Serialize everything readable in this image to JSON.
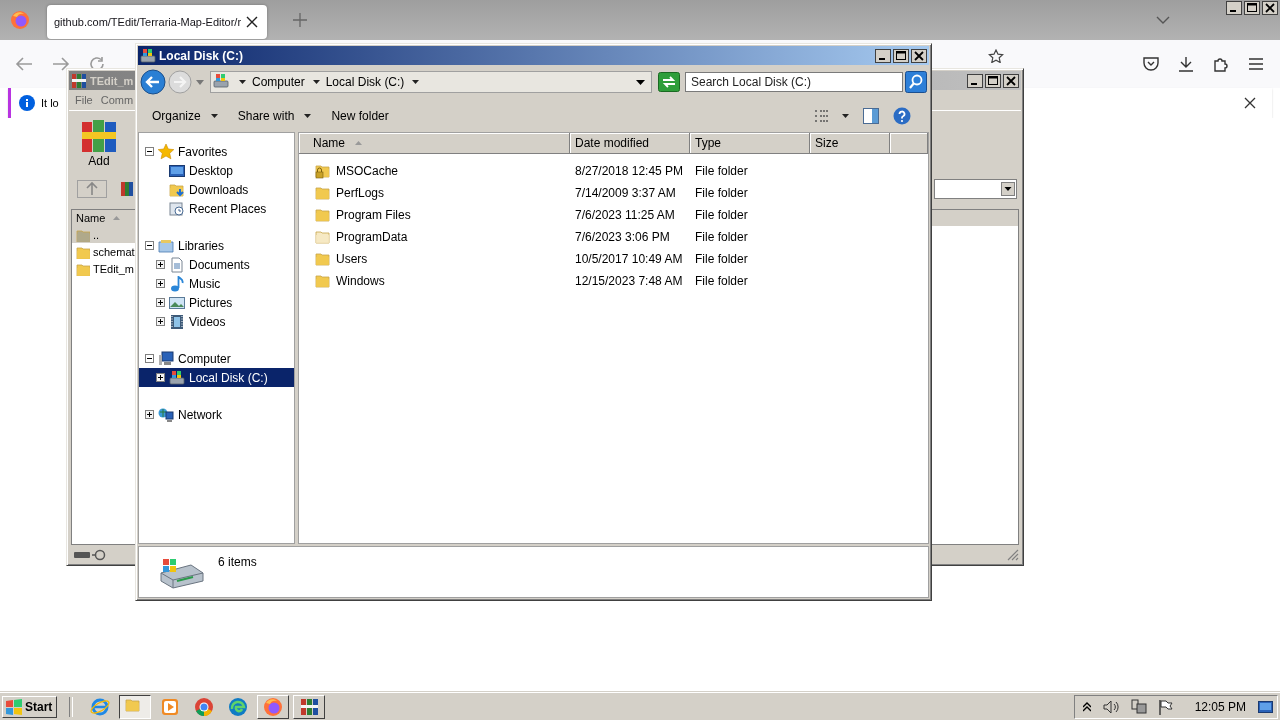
{
  "browser": {
    "tabs": [
      {
        "title": "github.com/TEdit/Terraria-Map-Editor/r",
        "selected": true
      }
    ],
    "notification": {
      "text": "It lo"
    }
  },
  "winrar": {
    "title": "TEdit_m",
    "menu": [
      "File",
      "Comm"
    ],
    "toolbar": [
      {
        "label": "Add"
      }
    ],
    "columns": [
      {
        "label": "Name",
        "sorted": true
      }
    ],
    "rows": [
      {
        "name": "..",
        "kind": "parent",
        "selected": true
      },
      {
        "name": "schemat",
        "kind": "folder",
        "selected": false
      },
      {
        "name": "TEdit_m",
        "kind": "folder",
        "selected": false
      }
    ]
  },
  "explorer": {
    "title": "Local Disk (C:)",
    "breadcrumb": [
      "Computer",
      "Local Disk (C:)"
    ],
    "search": {
      "placeholder": "Search Local Disk (C:)"
    },
    "toolbar": [
      {
        "label": "Organize",
        "menu": true
      },
      {
        "label": "Share with",
        "menu": true
      },
      {
        "label": "New folder",
        "menu": false
      }
    ],
    "nav_tree": [
      {
        "label": "Favorites",
        "kind": "favorites",
        "expanded": true,
        "selected": false,
        "children": [
          {
            "label": "Desktop",
            "kind": "desktop",
            "selected": false
          },
          {
            "label": "Downloads",
            "kind": "downloads",
            "selected": false
          },
          {
            "label": "Recent Places",
            "kind": "recent",
            "selected": false
          }
        ]
      },
      {
        "label": "Libraries",
        "kind": "libraries",
        "expanded": true,
        "selected": false,
        "children": [
          {
            "label": "Documents",
            "kind": "documents",
            "expanded": false,
            "selected": false
          },
          {
            "label": "Music",
            "kind": "music",
            "expanded": false,
            "selected": false
          },
          {
            "label": "Pictures",
            "kind": "pictures",
            "expanded": false,
            "selected": false
          },
          {
            "label": "Videos",
            "kind": "videos",
            "expanded": false,
            "selected": false
          }
        ]
      },
      {
        "label": "Computer",
        "kind": "computer",
        "expanded": true,
        "selected": false,
        "children": [
          {
            "label": "Local Disk (C:)",
            "kind": "disk",
            "expanded": false,
            "selected": true
          }
        ]
      },
      {
        "label": "Network",
        "kind": "network",
        "expanded": false,
        "selected": false
      }
    ],
    "columns": [
      {
        "label": "Name",
        "sorted": true
      },
      {
        "label": "Date modified",
        "sorted": false
      },
      {
        "label": "Type",
        "sorted": false
      },
      {
        "label": "Size",
        "sorted": false
      }
    ],
    "rows": [
      {
        "name": "MSOCache",
        "date": "8/27/2018 12:45 PM",
        "type": "File folder",
        "locked": true,
        "hidden": false,
        "selected": false
      },
      {
        "name": "PerfLogs",
        "date": "7/14/2009 3:37 AM",
        "type": "File folder",
        "locked": false,
        "hidden": false,
        "selected": false
      },
      {
        "name": "Program Files",
        "date": "7/6/2023 11:25 AM",
        "type": "File folder",
        "locked": false,
        "hidden": false,
        "selected": false
      },
      {
        "name": "ProgramData",
        "date": "7/6/2023 3:06 PM",
        "type": "File folder",
        "locked": false,
        "hidden": true,
        "selected": false
      },
      {
        "name": "Users",
        "date": "10/5/2017 10:49 AM",
        "type": "File folder",
        "locked": false,
        "hidden": false,
        "selected": false
      },
      {
        "name": "Windows",
        "date": "12/15/2023 7:48 AM",
        "type": "File folder",
        "locked": false,
        "hidden": false,
        "selected": false
      }
    ],
    "status": {
      "count": "6 items"
    }
  },
  "taskbar": {
    "start": "Start",
    "apps": [
      {
        "kind": "ie",
        "open": false,
        "selected": false
      },
      {
        "kind": "explorer",
        "open": true,
        "selected": true
      },
      {
        "kind": "media",
        "open": false,
        "selected": false
      },
      {
        "kind": "chrome",
        "open": false,
        "selected": false
      },
      {
        "kind": "edge",
        "open": false,
        "selected": false
      },
      {
        "kind": "firefox",
        "open": true,
        "selected": false
      },
      {
        "kind": "winrar",
        "open": true,
        "selected": false
      }
    ],
    "clock": "12:05 PM"
  }
}
